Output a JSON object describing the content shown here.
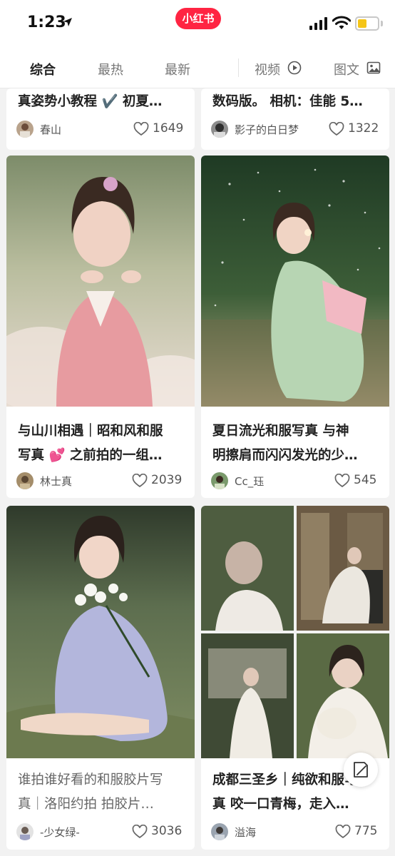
{
  "status_bar": {
    "time": "1:23",
    "app_badge": "小红书"
  },
  "tabs": [
    {
      "label": "综合",
      "active": true
    },
    {
      "label": "最热"
    },
    {
      "label": "最新"
    },
    {
      "label": "视频",
      "icon": "play-circle-icon"
    },
    {
      "label": "图文",
      "icon": "image-icon"
    }
  ],
  "cards": [
    {
      "title_lines": [
        "真姿势小教程 ✔️ 初夏…"
      ],
      "author": "春山",
      "likes": "1649"
    },
    {
      "title_lines": [
        "数码版。 相机：佳能 5…"
      ],
      "author": "影子的白日梦",
      "likes": "1322"
    },
    {
      "title_lines": [
        "与山川相遇｜昭和风和服",
        "写真 💕 之前拍的一组…"
      ],
      "author": "林士真",
      "likes": "2039"
    },
    {
      "title_lines": [
        "夏日流光和服写真 与神",
        "明擦肩而闪闪发光的少…"
      ],
      "author": "Cc_珏",
      "likes": "545"
    },
    {
      "title_lines": [
        "谁拍谁好看的和服胶片写",
        "真｜洛阳约拍 拍胶片…"
      ],
      "author": "-少女绿-",
      "likes": "3036"
    },
    {
      "title_lines": [
        "成都三圣乡｜纯欲和服写",
        "真 咬一口青梅，走入…"
      ],
      "author": "溢海",
      "likes": "775"
    }
  ],
  "colors": {
    "brand": "#ff2442",
    "battery": "#f5c518"
  }
}
